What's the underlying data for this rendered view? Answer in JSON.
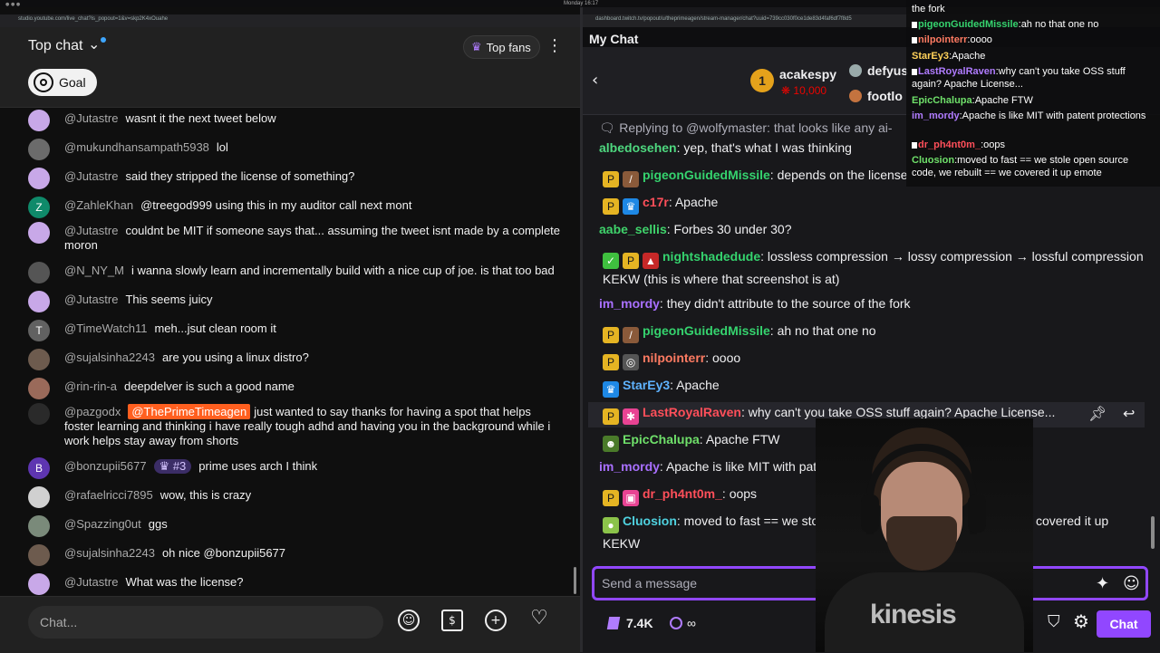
{
  "system": {
    "clock": "Monday 16:17"
  },
  "youtube": {
    "url": "studio.youtube.com/live_chat?is_popout=1&v=skp2K4xOuahe",
    "title": "Top chat",
    "top_fans_label": "Top fans",
    "goal_label": "Goal",
    "input_placeholder": "Chat...",
    "messages": [
      {
        "author": "@Jutastre",
        "text": "wasnt it the next tweet below",
        "avatar_color": "#c8a8e8",
        "avatar_text": ""
      },
      {
        "author": "@mukundhansampath5938",
        "text": "lol",
        "avatar_color": "#6b6b6b",
        "avatar_text": ""
      },
      {
        "author": "@Jutastre",
        "text": "said they stripped the license of something?",
        "avatar_color": "#c8a8e8",
        "avatar_text": ""
      },
      {
        "author": "@ZahleKhan",
        "text": "@treegod999 using this in my auditor call next mont",
        "avatar_color": "#0f8a6a",
        "avatar_text": "Z"
      },
      {
        "author": "@Jutastre",
        "text": "couldnt be MIT if someone says that... assuming the tweet isnt made by a complete moron",
        "avatar_color": "#c8a8e8",
        "avatar_text": ""
      },
      {
        "author": "@N_NY_M",
        "text": "i wanna slowly learn and incrementally build with a nice cup of joe. is that too bad",
        "avatar_color": "#555555",
        "avatar_text": ""
      },
      {
        "author": "@Jutastre",
        "text": "This seems juicy",
        "avatar_color": "#c8a8e8",
        "avatar_text": ""
      },
      {
        "author": "@TimeWatch11",
        "text": "meh...jsut clean room it",
        "avatar_color": "#616161",
        "avatar_text": "T"
      },
      {
        "author": "@sujalsinha2243",
        "text": "are you using a linux distro?",
        "avatar_color": "#6d5b4e",
        "avatar_text": ""
      },
      {
        "author": "@rin-rin-a",
        "text": "deepdelver is such a good name",
        "avatar_color": "#9a6a5a",
        "avatar_text": ""
      },
      {
        "author": "@pazgodx",
        "mention": "@ThePrimeTimeagen",
        "text": "just wanted to say thanks for having a spot that helps foster learning and thinking i have really tough adhd and having you in the background while i work helps stay away from shorts",
        "avatar_color": "#2a2a2a",
        "avatar_text": ""
      },
      {
        "author": "@bonzupii5677",
        "badge": "#3",
        "text": "prime uses arch I think",
        "avatar_color": "#5e35b1",
        "avatar_text": "B"
      },
      {
        "author": "@rafaelricci7895",
        "text": "wow, this is crazy",
        "avatar_color": "#d0d0d0",
        "avatar_text": ""
      },
      {
        "author": "@Spazzing0ut",
        "text": "ggs",
        "avatar_color": "#7a8a7a",
        "avatar_text": ""
      },
      {
        "author": "@sujalsinha2243",
        "text": "oh nice @bonzupii5677",
        "avatar_color": "#6d5b4e",
        "avatar_text": ""
      },
      {
        "author": "@Jutastre",
        "text": "What was the license?",
        "avatar_color": "#c8a8e8",
        "avatar_text": ""
      }
    ]
  },
  "twitch": {
    "url": "dashboard.twitch.tv/popout/u/theprimeagen/stream-manager/chat?uuid=739cc030f0ce1de83d4faf6df7f8d5",
    "title": "My Chat",
    "leaderboard": {
      "first_name": "acakespy",
      "first_points": "10,000",
      "first_rank": "1",
      "second_name": "defyus",
      "third_name": "footlo"
    },
    "reply_context": "Replying to @wolfymaster: that looks like any ai-",
    "messages": [
      {
        "name": "albedosehen",
        "color": "#4ed87f",
        "text": "yep, that's what I was thinking"
      },
      {
        "name": "pigeonGuidedMissile",
        "color": "#35d36e",
        "text": "depends on the license"
      },
      {
        "name": "c17r",
        "color": "#ff4f5a",
        "text": "Apache"
      },
      {
        "name": "aabe_sellis",
        "color": "#3fd36b",
        "text": "Forbes 30 under 30?"
      },
      {
        "name": "nightshadedude",
        "color": "#35d36e",
        "text": "lossless compression → lossy compression → lossful compression KEKW (this is where that screenshot is at)"
      },
      {
        "name": "im_mordy",
        "color": "#a970ff",
        "text": "they didn't attribute to the source of the fork"
      },
      {
        "name": "pigeonGuidedMissile",
        "color": "#35d36e",
        "text": "ah no that one no"
      },
      {
        "name": "nilpointerr",
        "color": "#ff7b62",
        "text": "oooo"
      },
      {
        "name": "StarEy3",
        "color": "#5fb3ff",
        "text": "Apache"
      },
      {
        "name": "LastRoyalRaven",
        "color": "#ff4f5a",
        "text": "why can't you take OSS stuff again? Apache License..."
      },
      {
        "name": "EpicChalupa",
        "color": "#6fe06a",
        "text": "Apache FTW"
      },
      {
        "name": "im_mordy",
        "color": "#a970ff",
        "text": "Apache is like MIT with patent prote"
      },
      {
        "name": "dr_ph4nt0m_",
        "color": "#ff4f5a",
        "text": "oops"
      },
      {
        "name": "Cluosion",
        "color": "#4fd2e0",
        "text": "moved to fast == we stole open source code, we rebuilt == we covered it up KEKW"
      }
    ],
    "input_placeholder": "Send a message",
    "points": "7.4K",
    "infinite": "∞",
    "chat_button": "Chat"
  },
  "overlay": {
    "lines": [
      {
        "name": "",
        "text": "the fork",
        "color": "#ffffff"
      },
      {
        "name": "pigeonGuidedMissile",
        "text": "ah no that one no",
        "color": "#35d36e"
      },
      {
        "name": "nilpointerr",
        "text": "oooo",
        "color": "#ff7b62"
      },
      {
        "name": "StarEy3",
        "text": "Apache",
        "color": "#ffd15a"
      },
      {
        "name": "LastRoyalRaven",
        "text": "why can't you take OSS stuff again? Apache License...",
        "color": "#b07cff"
      },
      {
        "name": "EpicChalupa",
        "text": "Apache FTW",
        "color": "#6fe06a"
      },
      {
        "name": "im_mordy",
        "text": "Apache is like MIT with patent protections",
        "color": "#b07cff"
      },
      {
        "name": "dr_ph4nt0m_",
        "text": "oops",
        "color": "#ff4f5a"
      },
      {
        "name": "Cluosion",
        "text": "moved to fast == we stole open source code, we rebuilt == we covered it up",
        "color": "#6fe06a"
      }
    ],
    "emote_alt": "emote"
  },
  "webcam": {
    "logo": "kinesis"
  },
  "colors": {
    "accent_twitch": "#9147ff",
    "accent_yt_mention": "#ff5f1f",
    "youtube_bg": "#0f0f0f",
    "twitch_bg": "#18181b"
  }
}
